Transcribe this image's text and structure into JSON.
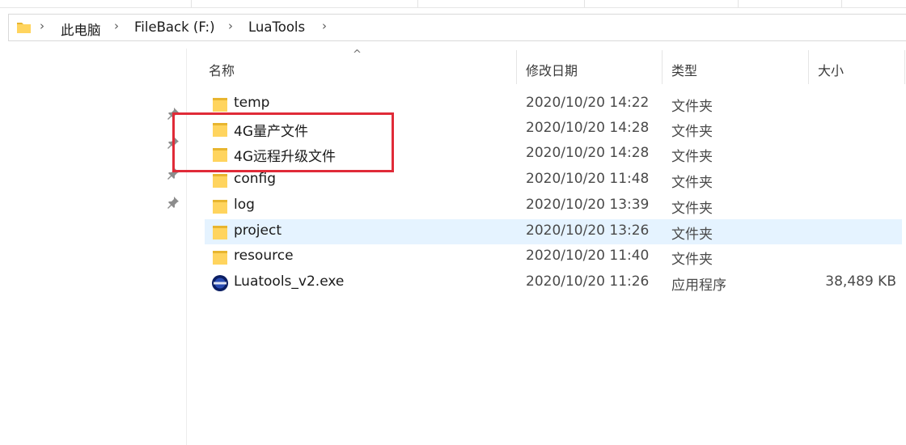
{
  "breadcrumb": {
    "items": [
      {
        "label": "此电脑"
      },
      {
        "label": "FileBack (F:)"
      },
      {
        "label": "LuaTools"
      }
    ]
  },
  "columns": {
    "name": "名称",
    "date": "修改日期",
    "type": "类型",
    "size": "大小"
  },
  "files": [
    {
      "name": " temp",
      "date": "2020/10/20 14:22",
      "type": "文件夹",
      "size": "",
      "icon": "folder-icon"
    },
    {
      "name": "4G量产文件",
      "date": "2020/10/20 14:28",
      "type": "文件夹",
      "size": "",
      "icon": "folder-icon"
    },
    {
      "name": "4G远程升级文件",
      "date": "2020/10/20 14:28",
      "type": "文件夹",
      "size": "",
      "icon": "folder-icon"
    },
    {
      "name": "config",
      "date": "2020/10/20 11:48",
      "type": "文件夹",
      "size": "",
      "icon": "folder-icon"
    },
    {
      "name": "log",
      "date": "2020/10/20 13:39",
      "type": "文件夹",
      "size": "",
      "icon": "folder-icon"
    },
    {
      "name": "project",
      "date": "2020/10/20 13:26",
      "type": "文件夹",
      "size": "",
      "icon": "folder-icon",
      "selected": true
    },
    {
      "name": "resource",
      "date": "2020/10/20 11:40",
      "type": "文件夹",
      "size": "",
      "icon": "folder-icon"
    },
    {
      "name": "Luatools_v2.exe",
      "date": "2020/10/20 11:26",
      "type": "应用程序",
      "size": "38,489 KB",
      "icon": "luatools-app-icon"
    }
  ],
  "colors": {
    "highlight": "#e02b38",
    "selection": "#e5f3ff",
    "folder": "#ffd45e"
  }
}
